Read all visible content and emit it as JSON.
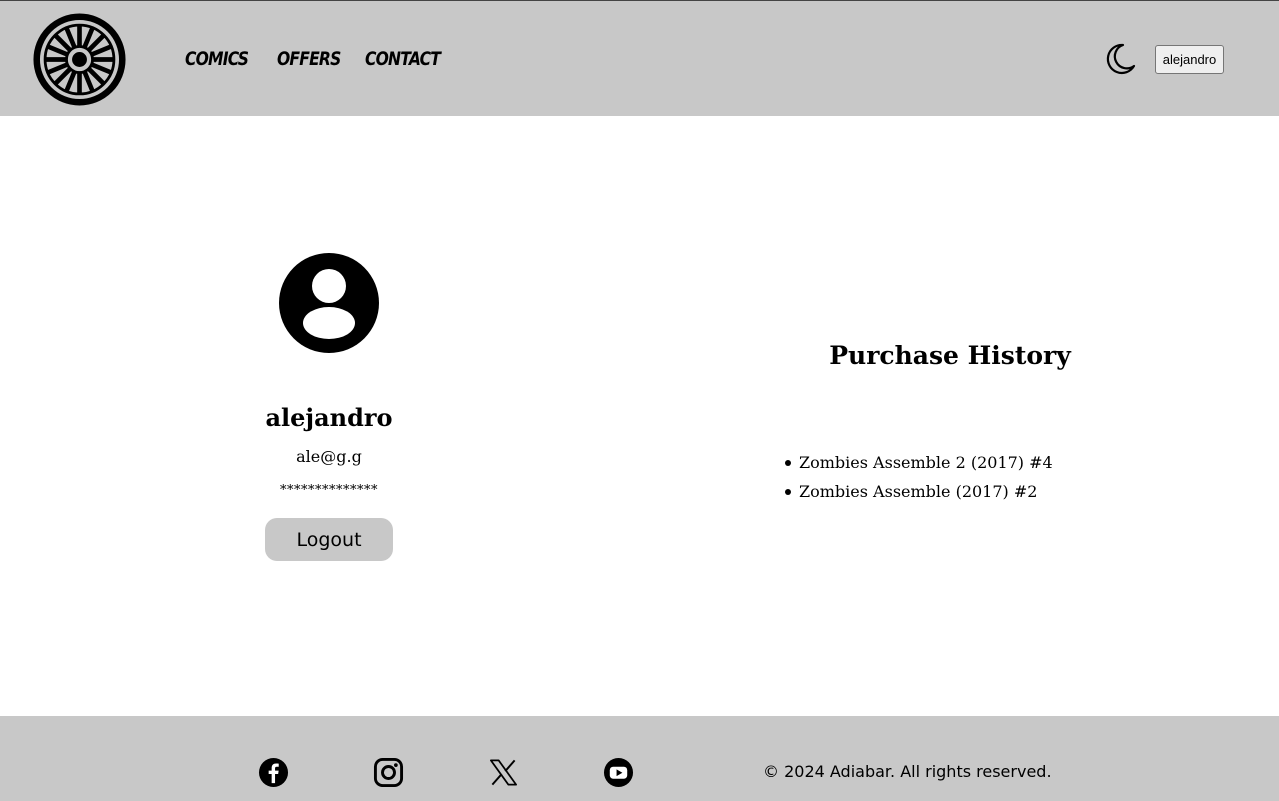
{
  "header": {
    "logo_icon": "wheel-logo-icon",
    "nav": [
      "Comics",
      "Offers",
      "Contact"
    ],
    "theme_icon": "moon-icon",
    "user_button": "alejandro"
  },
  "profile": {
    "avatar_icon": "user-circle-icon",
    "name": "alejandro",
    "email": "ale@g.g",
    "password_mask": "**************",
    "logout_label": "Logout"
  },
  "purchase_history": {
    "title": "Purchase History",
    "items": [
      "Zombies Assemble 2 (2017) #4",
      "Zombies Assemble (2017) #2"
    ]
  },
  "footer": {
    "social_icons": [
      "facebook-icon",
      "instagram-icon",
      "x-icon",
      "youtube-icon"
    ],
    "copyright": "© 2024 Adiabar. All rights reserved."
  },
  "colors": {
    "header_bg": "#c8c8c8",
    "footer_bg": "#c8c8c8",
    "button_bg": "#c8c8c8",
    "text": "#000000",
    "page_bg": "#ffffff"
  }
}
